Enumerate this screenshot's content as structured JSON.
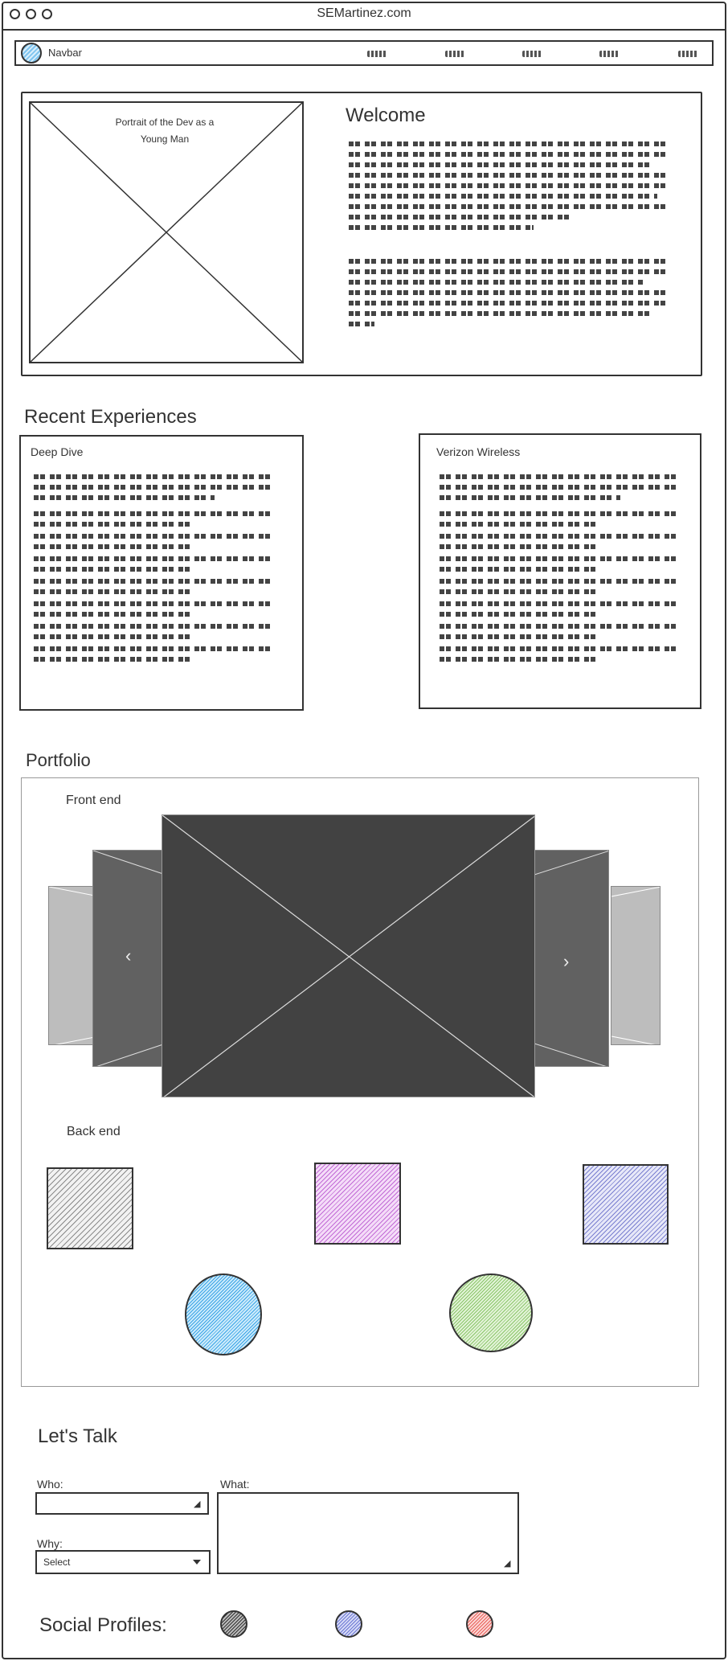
{
  "window": {
    "title": "SEMartinez.com"
  },
  "navbar": {
    "label": "Navbar",
    "link_count": 5
  },
  "welcome": {
    "portrait_caption": "Portrait of the Dev as a Young Man",
    "heading": "Welcome"
  },
  "recent": {
    "heading": "Recent Experiences",
    "cards": [
      {
        "title": "Deep Dive"
      },
      {
        "title": "Verizon Wireless"
      }
    ]
  },
  "portfolio": {
    "heading": "Portfolio",
    "frontend_label": "Front end",
    "backend_label": "Back end",
    "prev_icon": "chevron-left-icon",
    "next_icon": "chevron-right-icon",
    "backend_colors": [
      "#555555",
      "#c26bd6",
      "#7a7fd0",
      "#3aa4e6",
      "#8bc66a"
    ]
  },
  "contact": {
    "heading": "Let's Talk",
    "who_label": "Who:",
    "what_label": "What:",
    "why_label": "Why:",
    "why_select_value": "Select"
  },
  "social": {
    "heading": "Social Profiles:",
    "colors": [
      "#333333",
      "#6c78d4",
      "#e8605a"
    ]
  }
}
